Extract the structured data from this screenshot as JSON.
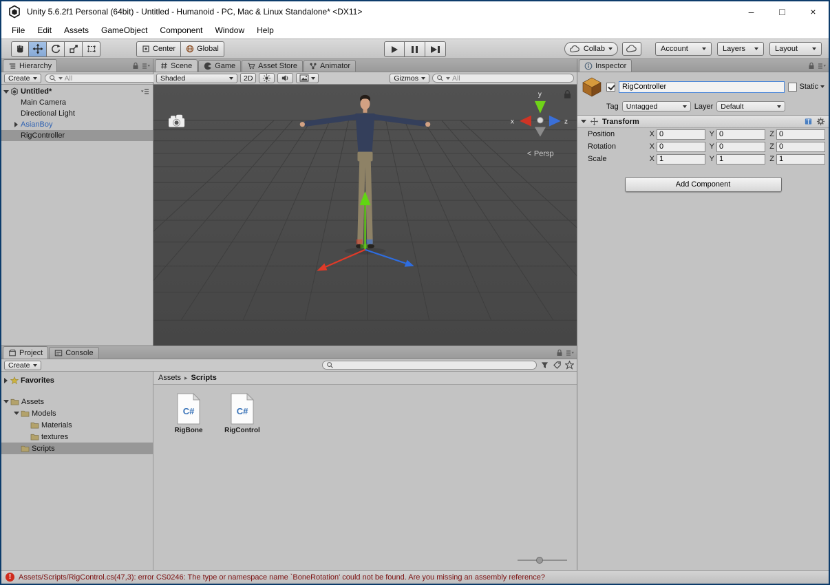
{
  "window": {
    "title": "Unity 5.6.2f1 Personal (64bit) - Untitled - Humanoid - PC, Mac & Linux Standalone* <DX11>",
    "minimize": "–",
    "maximize": "□",
    "close": "×"
  },
  "menubar": {
    "items": [
      "File",
      "Edit",
      "Assets",
      "GameObject",
      "Component",
      "Window",
      "Help"
    ]
  },
  "toolbar": {
    "center": "Center",
    "global": "Global",
    "collab": "Collab",
    "account": "Account",
    "layers": "Layers",
    "layout": "Layout"
  },
  "hierarchy": {
    "tab": "Hierarchy",
    "create": "Create",
    "search_placeholder": "All",
    "root": "Untitled*",
    "items": [
      {
        "label": "Main Camera"
      },
      {
        "label": "Directional Light"
      },
      {
        "label": "AsianBoy"
      },
      {
        "label": "RigController"
      }
    ]
  },
  "scene": {
    "tabs": {
      "scene": "Scene",
      "game": "Game",
      "asset_store": "Asset Store",
      "animator": "Animator"
    },
    "shaded": "Shaded",
    "mode_2d": "2D",
    "gizmos": "Gizmos",
    "search_placeholder": "All",
    "axis": {
      "x": "x",
      "y": "y",
      "z": "z"
    },
    "persp_arrow": "<",
    "persp": "Persp"
  },
  "inspector": {
    "tab": "Inspector",
    "name": "RigController",
    "static": "Static",
    "tag_label": "Tag",
    "tag_value": "Untagged",
    "layer_label": "Layer",
    "layer_value": "Default",
    "transform": {
      "title": "Transform",
      "axes": {
        "x": "X",
        "y": "Y",
        "z": "Z"
      },
      "rows": [
        {
          "label": "Position",
          "x": "0",
          "y": "0",
          "z": "0"
        },
        {
          "label": "Rotation",
          "x": "0",
          "y": "0",
          "z": "0"
        },
        {
          "label": "Scale",
          "x": "1",
          "y": "1",
          "z": "1"
        }
      ]
    },
    "add_component": "Add Component"
  },
  "project": {
    "tab": "Project",
    "console_tab": "Console",
    "create": "Create",
    "favorites": "Favorites",
    "tree": {
      "assets": "Assets",
      "models": "Models",
      "materials": "Materials",
      "textures": "textures",
      "scripts": "Scripts"
    },
    "breadcrumb": {
      "root": "Assets",
      "separator": "▸",
      "current": "Scripts"
    },
    "files": [
      {
        "name": "RigBone",
        "icon_text": "C#"
      },
      {
        "name": "RigControl",
        "icon_text": "C#"
      }
    ]
  },
  "statusbar": {
    "icon": "!",
    "error": "Assets/Scripts/RigControl.cs(47,3): error CS0246: The type or namespace name `BoneRotation' could not be found. Are you missing an assembly reference?"
  },
  "colors": {
    "selection": "#979797",
    "prefab_text": "#2f62b2",
    "error_text": "#7d1212",
    "axis_x": "#e03a28",
    "axis_y": "#61d612",
    "axis_z": "#2e6de0"
  }
}
